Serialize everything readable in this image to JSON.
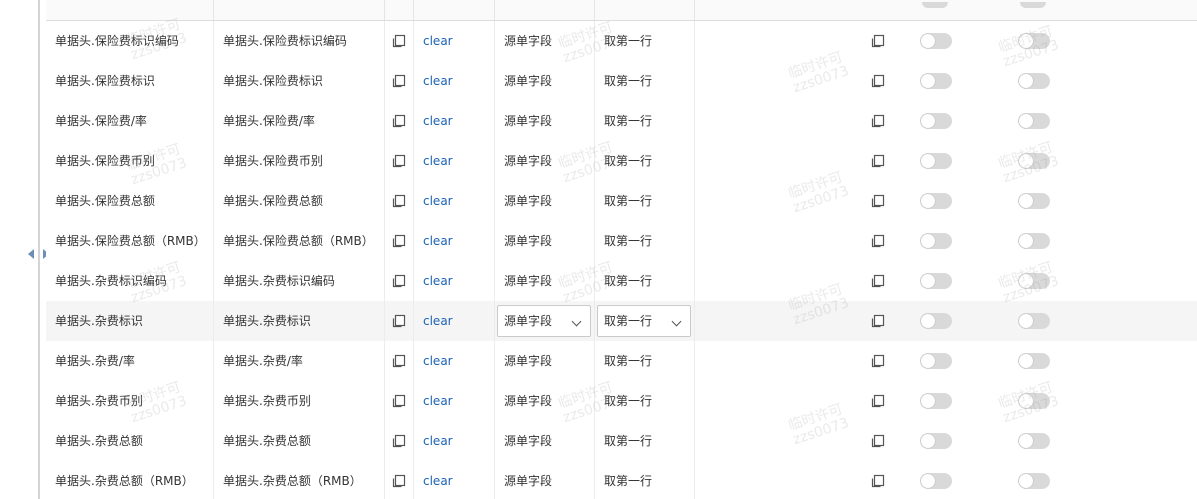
{
  "watermark": {
    "line1": "临时许可",
    "line2": "zzs0073"
  },
  "rows": [
    {
      "source_field": "单据头.保险费标识编码",
      "target_field": "单据头.保险费标识编码",
      "action": "clear",
      "type": "源单字段",
      "rule": "取第一行"
    },
    {
      "source_field": "单据头.保险费标识",
      "target_field": "单据头.保险费标识",
      "action": "clear",
      "type": "源单字段",
      "rule": "取第一行"
    },
    {
      "source_field": "单据头.保险费/率",
      "target_field": "单据头.保险费/率",
      "action": "clear",
      "type": "源单字段",
      "rule": "取第一行"
    },
    {
      "source_field": "单据头.保险费币别",
      "target_field": "单据头.保险费币别",
      "action": "clear",
      "type": "源单字段",
      "rule": "取第一行"
    },
    {
      "source_field": "单据头.保险费总额",
      "target_field": "单据头.保险费总额",
      "action": "clear",
      "type": "源单字段",
      "rule": "取第一行"
    },
    {
      "source_field": "单据头.保险费总额（RMB）",
      "target_field": "单据头.保险费总额（RMB）",
      "action": "clear",
      "type": "源单字段",
      "rule": "取第一行"
    },
    {
      "source_field": "单据头.杂费标识编码",
      "target_field": "单据头.杂费标识编码",
      "action": "clear",
      "type": "源单字段",
      "rule": "取第一行"
    },
    {
      "source_field": "单据头.杂费标识",
      "target_field": "单据头.杂费标识",
      "action": "clear",
      "type": "源单字段",
      "rule": "取第一行"
    },
    {
      "source_field": "单据头.杂费/率",
      "target_field": "单据头.杂费/率",
      "action": "clear",
      "type": "源单字段",
      "rule": "取第一行"
    },
    {
      "source_field": "单据头.杂费币别",
      "target_field": "单据头.杂费币别",
      "action": "clear",
      "type": "源单字段",
      "rule": "取第一行"
    },
    {
      "source_field": "单据头.杂费总额",
      "target_field": "单据头.杂费总额",
      "action": "clear",
      "type": "源单字段",
      "rule": "取第一行"
    },
    {
      "source_field": "单据头.杂费总额（RMB）",
      "target_field": "单据头.杂费总额（RMB）",
      "action": "clear",
      "type": "源单字段",
      "rule": "取第一行"
    }
  ],
  "active_row_index": 7,
  "icons": {
    "copy": "copy-icon",
    "expand_left": "triangle-left-icon",
    "expand_right": "triangle-right-icon",
    "dropdown": "chevron-down-icon"
  },
  "colors": {
    "link": "#1e63b4",
    "toggle_off": "#d9d9d9",
    "active_row": "#f5f5f5",
    "splitter": "#6b8fb6"
  },
  "toggles": {
    "state": "off"
  }
}
